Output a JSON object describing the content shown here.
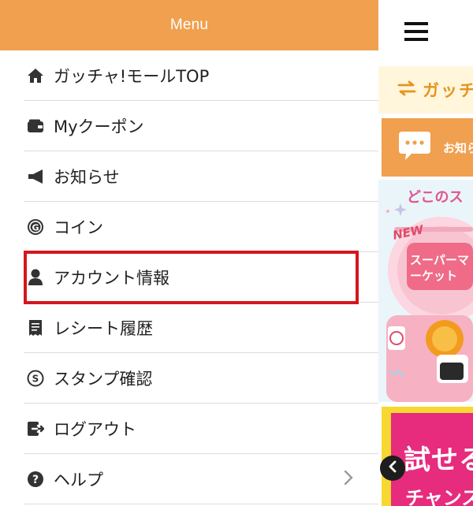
{
  "drawer": {
    "title": "Menu",
    "items": [
      {
        "label": "ガッチャ!モールTOP",
        "icon": "home-icon"
      },
      {
        "label": "Myクーポン",
        "icon": "wallet-icon"
      },
      {
        "label": "お知らせ",
        "icon": "megaphone-icon"
      },
      {
        "label": "コイン",
        "icon": "coin-icon"
      },
      {
        "label": "アカウント情報",
        "icon": "user-icon",
        "highlighted": true
      },
      {
        "label": "レシート履歴",
        "icon": "receipt-icon"
      },
      {
        "label": "スタンプ確認",
        "icon": "stamp-icon"
      },
      {
        "label": "ログアウト",
        "icon": "logout-icon"
      },
      {
        "label": "ヘルプ",
        "icon": "help-icon",
        "chevron": "chevron-right-icon"
      }
    ]
  },
  "app": {
    "menu_icon": "hamburger-icon",
    "gacha_bar": {
      "icon": "swap-arrows-icon",
      "text": "ガッチ"
    },
    "notice_bar": {
      "icon": "chat-bubble-icon",
      "text": "お知ら"
    },
    "banner1": {
      "headline": "どこのス",
      "badge": "NEW",
      "product_text": "スーパーマーケット"
    },
    "banner2": {
      "line1": "試せる",
      "line2": "チャンス"
    },
    "back_button_icon": "chevron-left-icon"
  },
  "colors": {
    "accent": "#f0a04e",
    "highlight_border": "#d5161e",
    "icon": "#333333",
    "gacha_text": "#e8931f",
    "banner_pink": "#e72b7d"
  }
}
